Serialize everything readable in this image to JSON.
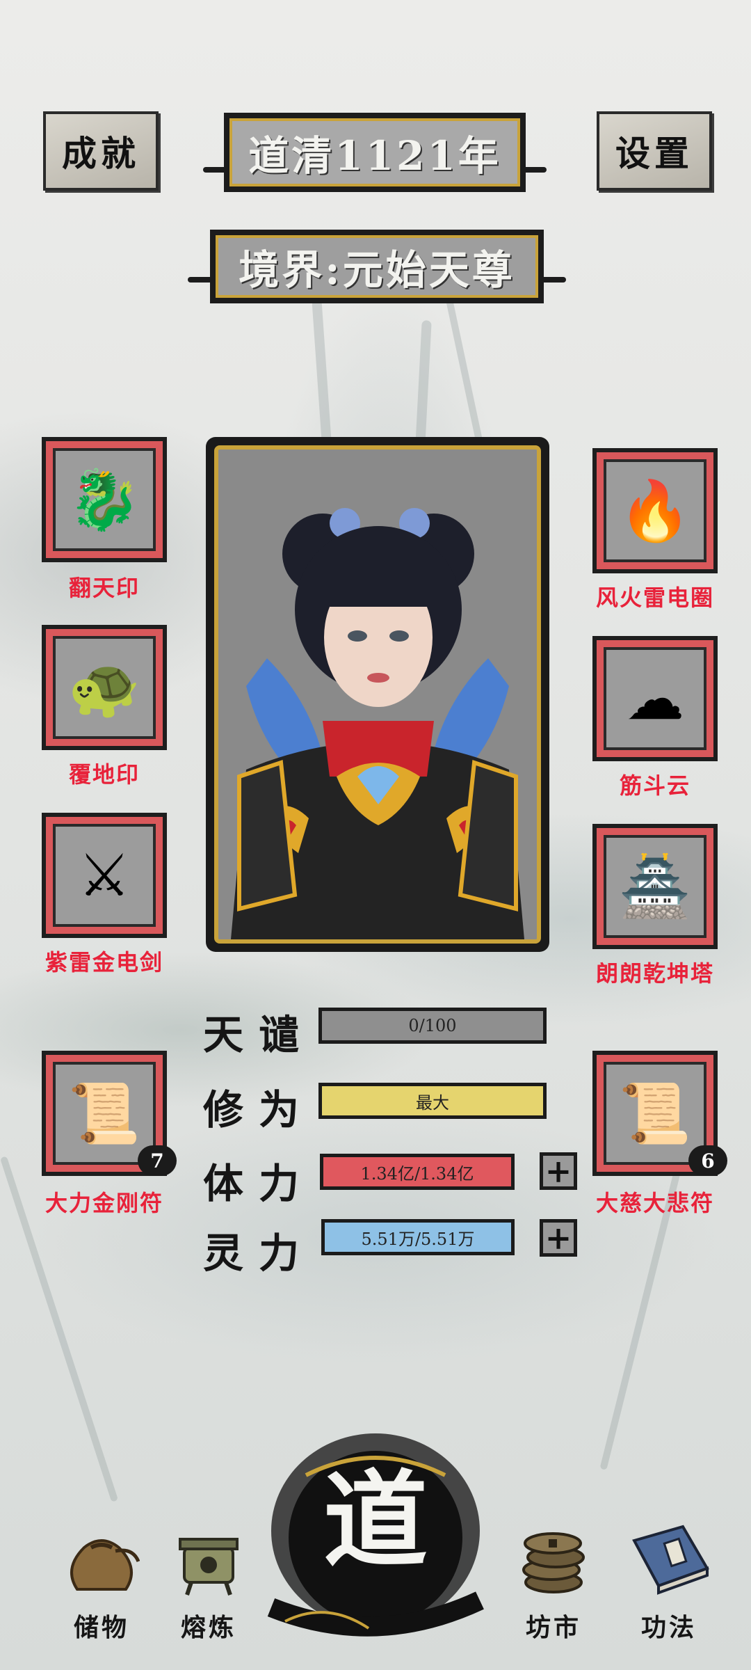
{
  "header": {
    "achievements_label": "成就",
    "year_label": "道清1121年",
    "settings_label": "设置",
    "realm_label": "境界:元始天尊"
  },
  "equipment_left": [
    {
      "name": "翻天印",
      "icon": "dragon-seal-icon",
      "glyph": "🐉"
    },
    {
      "name": "覆地印",
      "icon": "turtle-seal-icon",
      "glyph": "🐢"
    },
    {
      "name": "紫雷金电剑",
      "icon": "thunder-sword-icon",
      "glyph": "⚔"
    },
    {
      "name": "大力金刚符",
      "icon": "talisman-scroll-icon",
      "glyph": "📜",
      "count": "7"
    }
  ],
  "equipment_right": [
    {
      "name": "风火雷电圈",
      "icon": "fire-ring-icon",
      "glyph": "🔥"
    },
    {
      "name": "筋斗云",
      "icon": "cloud-icon",
      "glyph": "☁"
    },
    {
      "name": "朗朗乾坤塔",
      "icon": "pagoda-icon",
      "glyph": "🏯"
    },
    {
      "name": "大慈大悲符",
      "icon": "talisman-scroll-icon",
      "glyph": "📜",
      "count": "6"
    }
  ],
  "stats": {
    "tianqian": {
      "label": "天谴",
      "value": "0/100",
      "fill": 0.0
    },
    "xiuwei": {
      "label": "修为",
      "value": "最大",
      "fill": 1.0
    },
    "tili": {
      "label": "体力",
      "value": "1.34亿/1.34亿",
      "fill": 1.0
    },
    "lingli": {
      "label": "灵力",
      "value": "5.51万/5.51万",
      "fill": 1.0
    }
  },
  "colors": {
    "slot_border": "#d9585b",
    "label_red": "#e8223a",
    "bar_grey": "#8f8f8f",
    "bar_yellow": "#e5d46e",
    "bar_red": "#e0585e",
    "bar_blue": "#8ec1e6",
    "gold": "#c9a33a"
  },
  "nav": {
    "storage": {
      "label": "储物",
      "icon": "pouch-icon"
    },
    "smelting": {
      "label": "熔炼",
      "icon": "cauldron-icon"
    },
    "dao": {
      "label": "道",
      "icon": "dao-ink-icon"
    },
    "market": {
      "label": "坊市",
      "icon": "coins-icon"
    },
    "techniques": {
      "label": "功法",
      "icon": "book-icon"
    }
  }
}
